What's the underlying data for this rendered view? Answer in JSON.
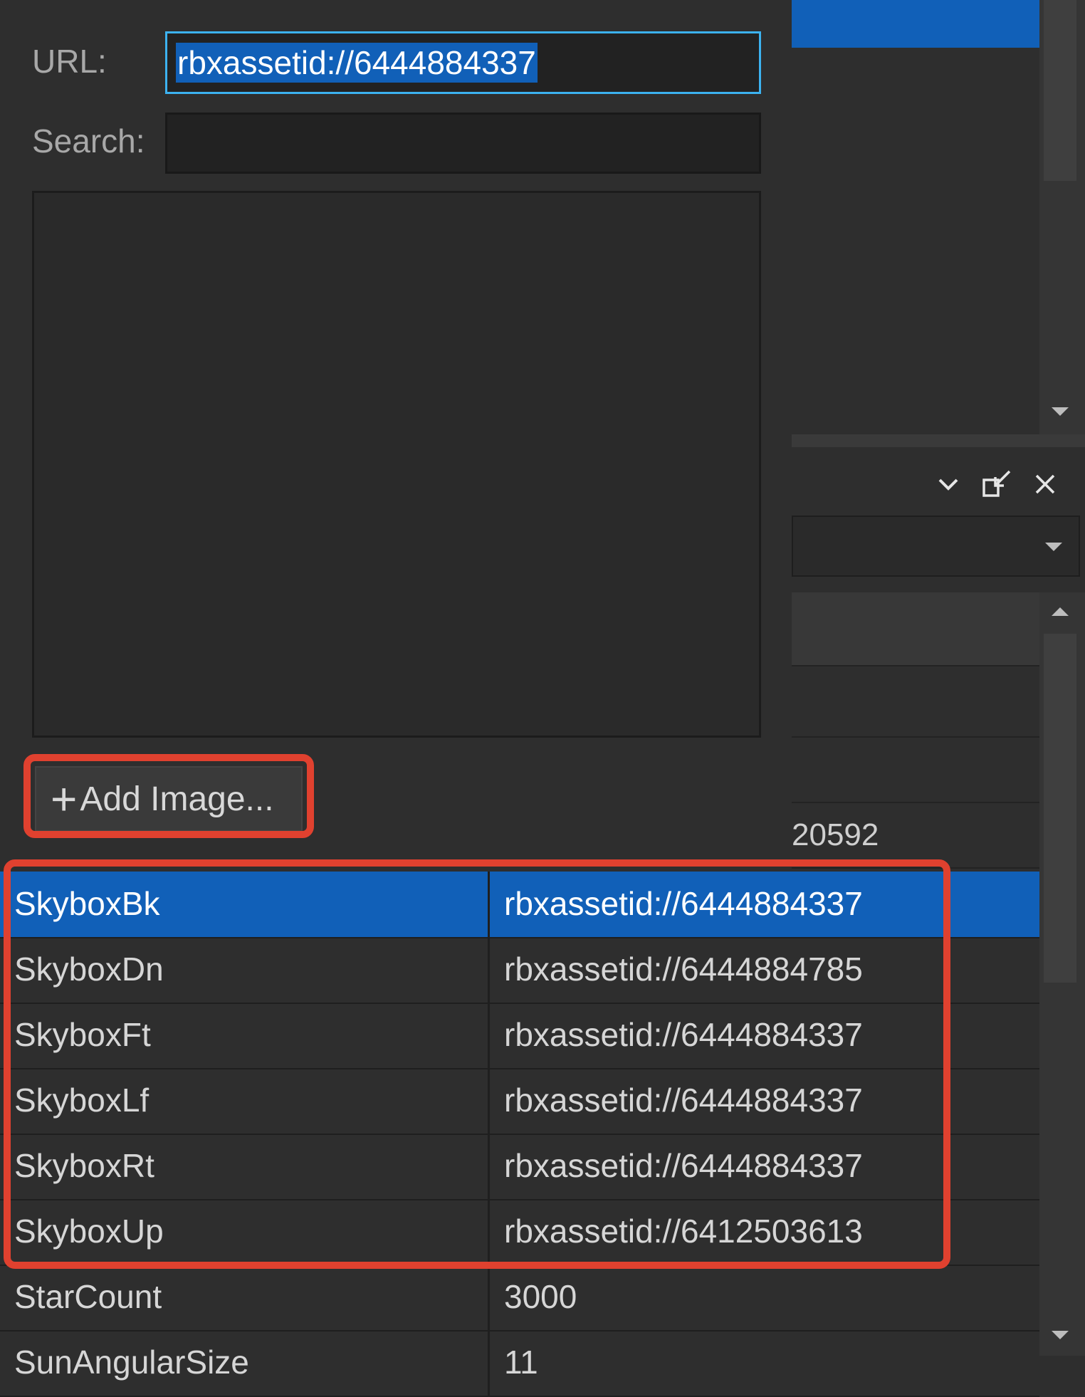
{
  "image_picker": {
    "url_label": "URL:",
    "url_value": "rbxassetid://6444884337",
    "search_label": "Search:",
    "search_value": "",
    "add_image_label": "Add Image..."
  },
  "properties": {
    "partial_value": "20592",
    "rows": [
      {
        "name": "SkyboxBk",
        "value": "rbxassetid://6444884337",
        "selected": true
      },
      {
        "name": "SkyboxDn",
        "value": "rbxassetid://6444884785"
      },
      {
        "name": "SkyboxFt",
        "value": "rbxassetid://6444884337"
      },
      {
        "name": "SkyboxLf",
        "value": "rbxassetid://6444884337"
      },
      {
        "name": "SkyboxRt",
        "value": "rbxassetid://6444884337"
      },
      {
        "name": "SkyboxUp",
        "value": "rbxassetid://6412503613"
      },
      {
        "name": "StarCount",
        "value": "3000"
      },
      {
        "name": "SunAngularSize",
        "value": "11"
      }
    ]
  },
  "icons": {
    "collapse": "chevron-down-icon",
    "undock": "undock-icon",
    "close": "close-icon",
    "add": "plus-icon"
  },
  "colors": {
    "selection": "#1160b8",
    "highlight": "#e0412f",
    "focus_border": "#3cb2f0"
  }
}
